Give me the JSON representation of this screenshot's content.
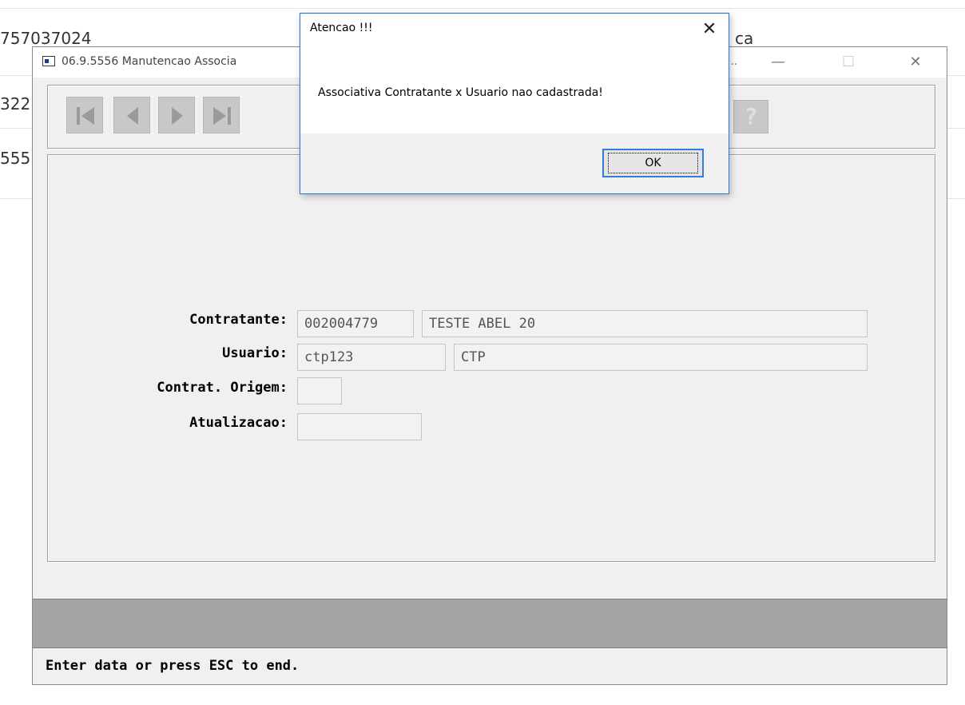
{
  "background": {
    "rows": [
      {
        "text": "757037024"
      },
      {
        "text": "322"
      },
      {
        "text": "555"
      }
    ],
    "right_text": "ca"
  },
  "window": {
    "title": "06.9.5556 Manutencao  Associa",
    "title_tail": "7...",
    "controls": {
      "minimize": "—",
      "maximize": "☐",
      "close": "✕"
    }
  },
  "toolbar": {
    "buttons": [
      {
        "name": "first-record-icon"
      },
      {
        "name": "previous-record-icon"
      },
      {
        "name": "next-record-icon"
      },
      {
        "name": "last-record-icon"
      }
    ],
    "help_label": "?"
  },
  "form": {
    "contratante_label": "Contratante:",
    "contratante_code": "002004779",
    "contratante_name": "TESTE ABEL 20",
    "usuario_label": "Usuario:",
    "usuario_code": "ctp123",
    "usuario_name": "CTP",
    "contrat_origem_label": "Contrat. Origem:",
    "contrat_origem_value": "",
    "atualizacao_label": "Atualizacao:",
    "atualizacao_value": ""
  },
  "status": {
    "message": "Enter data or press ESC to end."
  },
  "dialog": {
    "title": "Atencao !!!",
    "close": "✕",
    "message": "Associativa Contratante x Usuario nao cadastrada!",
    "ok_label": "OK"
  },
  "colors": {
    "dialog_border": "#1e78d7",
    "window_bg": "#f0f0f0",
    "status_band": "#a4a4a4"
  }
}
